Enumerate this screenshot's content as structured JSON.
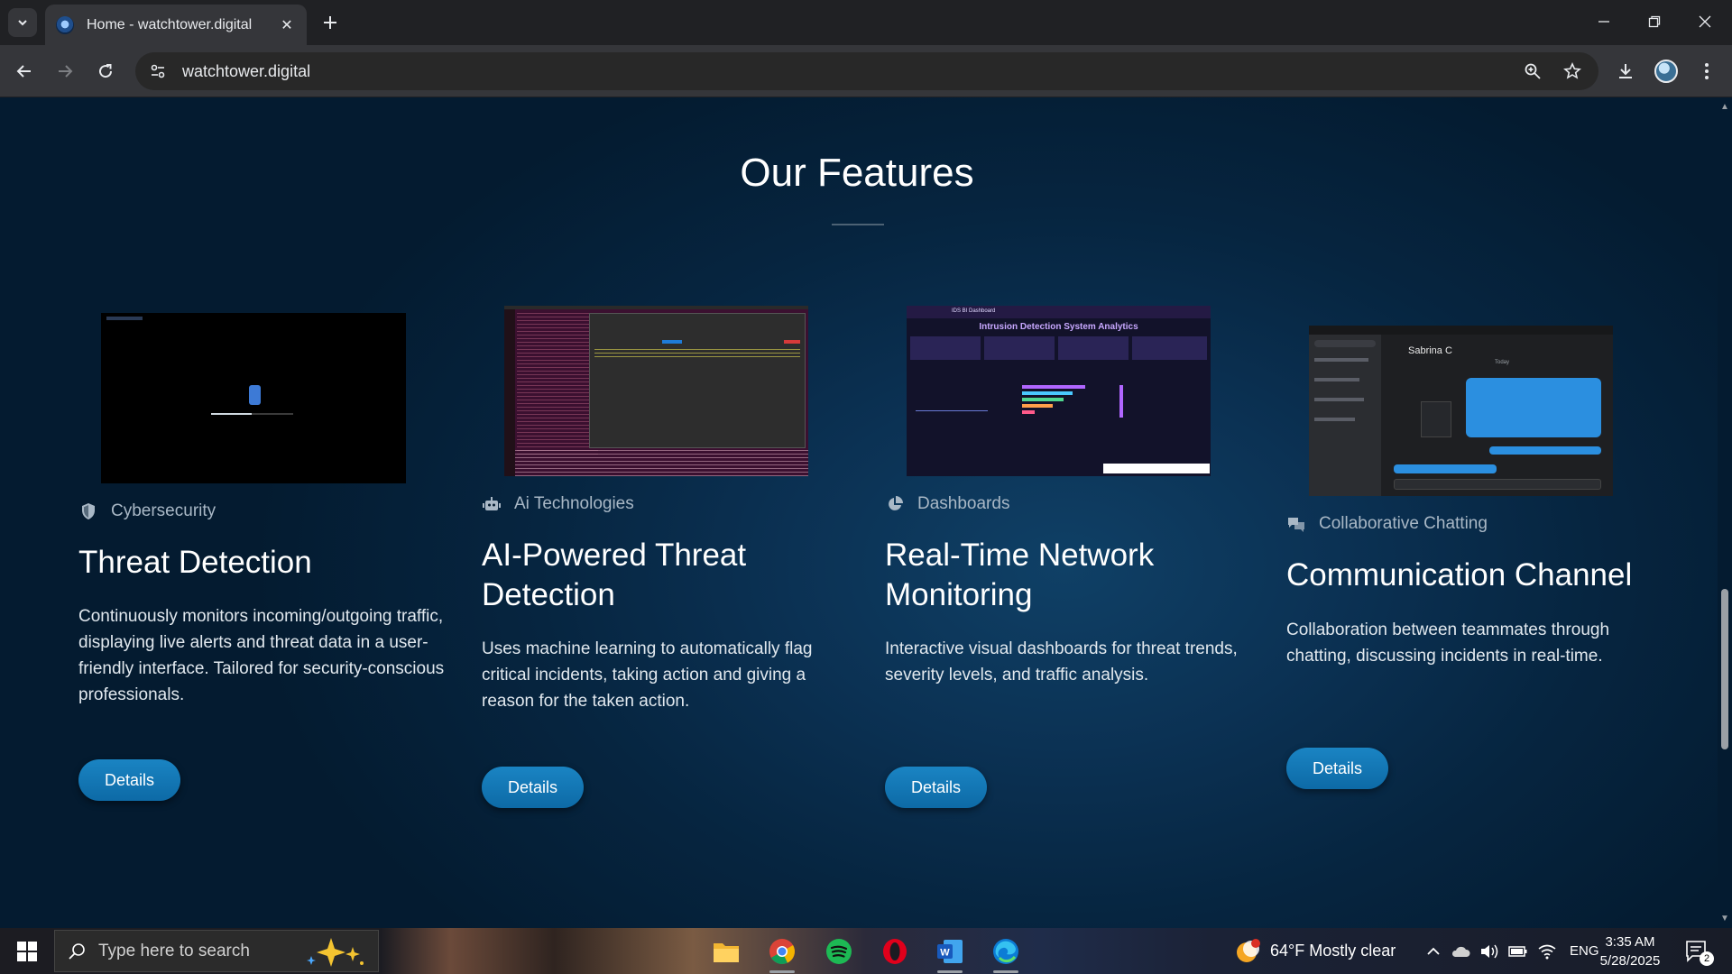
{
  "browser": {
    "tab_title": "Home - watchtower.digital",
    "url": "watchtower.digital"
  },
  "page": {
    "section_title": "Our Features",
    "features": [
      {
        "category": "Cybersecurity",
        "category_icon": "shield-icon",
        "title": "Threat Detection",
        "description": "Continuously monitors incoming/outgoing traffic, displaying live alerts and threat data in a user-friendly interface. Tailored for security-conscious professionals.",
        "button": "Details"
      },
      {
        "category": "Ai Technologies",
        "category_icon": "robot-icon",
        "title": "AI-Powered Threat Detection",
        "description": "Uses machine learning to automatically flag critical incidents, taking action and giving a reason for the taken action.",
        "button": "Details"
      },
      {
        "category": "Dashboards",
        "category_icon": "pie-chart-icon",
        "title": "Real-Time Network Monitoring",
        "description": "Interactive visual dashboards for threat trends, severity levels, and traffic analysis.",
        "button": "Details",
        "screenshot_heading": "IDS BI Dashboard",
        "screenshot_title": "Intrusion Detection System Analytics"
      },
      {
        "category": "Collaborative Chatting",
        "category_icon": "chat-icon",
        "title": "Communication Channel",
        "description": "Collaboration between teammates through chatting, discussing incidents in real-time.",
        "button": "Details",
        "screenshot_contact": "Sabrina C",
        "screenshot_date": "Today"
      }
    ]
  },
  "taskbar": {
    "search_placeholder": "Type here to search",
    "weather": "64°F  Mostly clear",
    "language": "ENG",
    "time": "3:35 AM",
    "date": "5/28/2025",
    "notifications": "2"
  },
  "colors": {
    "accent_button": "#1a84c3",
    "page_bg": "#062540"
  }
}
